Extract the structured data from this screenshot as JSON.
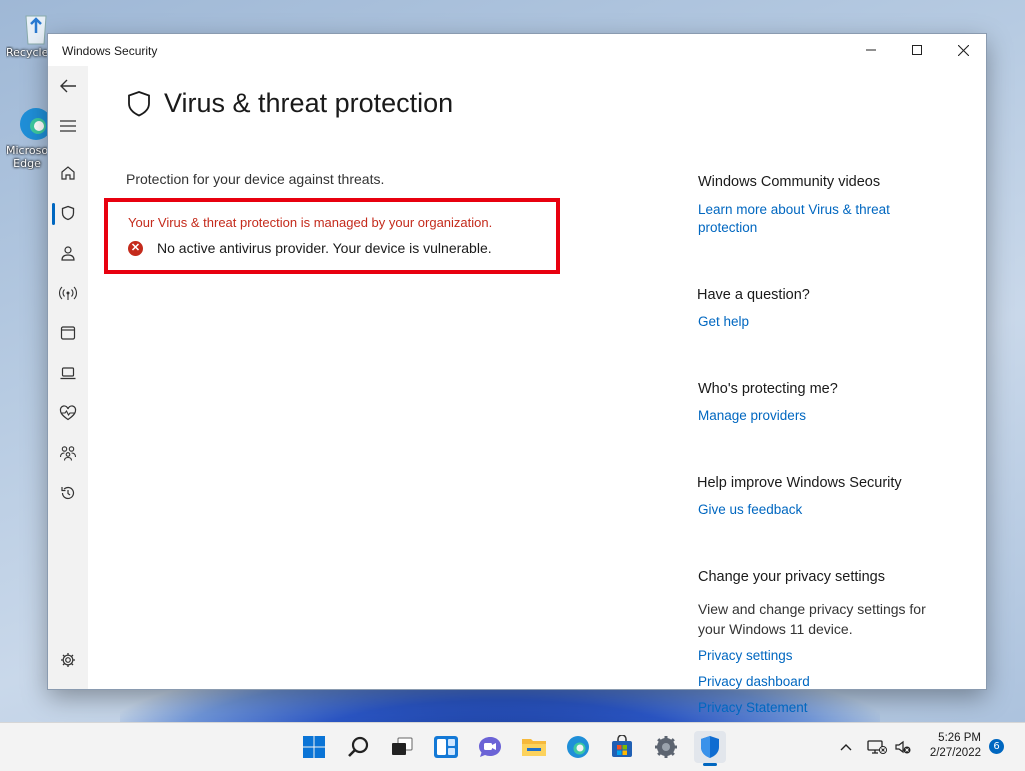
{
  "desktop": {
    "icons": [
      {
        "label": "Recycle Bin"
      },
      {
        "label": "Microsoft Edge"
      }
    ]
  },
  "window": {
    "title": "Windows Security"
  },
  "page": {
    "title": "Virus & threat protection",
    "subtitle": "Protection for your device against threats.",
    "alert": {
      "org_message": "Your Virus & threat protection is managed by your organization.",
      "warning": "No active antivirus provider. Your device is vulnerable."
    }
  },
  "sidebar_right": {
    "community": {
      "heading": "Windows Community videos",
      "link": "Learn more about Virus & threat protection"
    },
    "question": {
      "heading": "Have a question?",
      "link": "Get help"
    },
    "protecting": {
      "heading": "Who's protecting me?",
      "link": "Manage providers"
    },
    "improve": {
      "heading": "Help improve Windows Security",
      "link": "Give us feedback"
    },
    "privacy": {
      "heading": "Change your privacy settings",
      "text": "View and change privacy settings for your Windows 11 device.",
      "links": [
        "Privacy settings",
        "Privacy dashboard",
        "Privacy Statement"
      ]
    }
  },
  "taskbar": {
    "time": "5:26 PM",
    "date": "2/27/2022",
    "notification_count": "6"
  },
  "colors": {
    "accent": "#0067c0",
    "alert_border": "#e8000f",
    "error": "#c42b1c"
  }
}
